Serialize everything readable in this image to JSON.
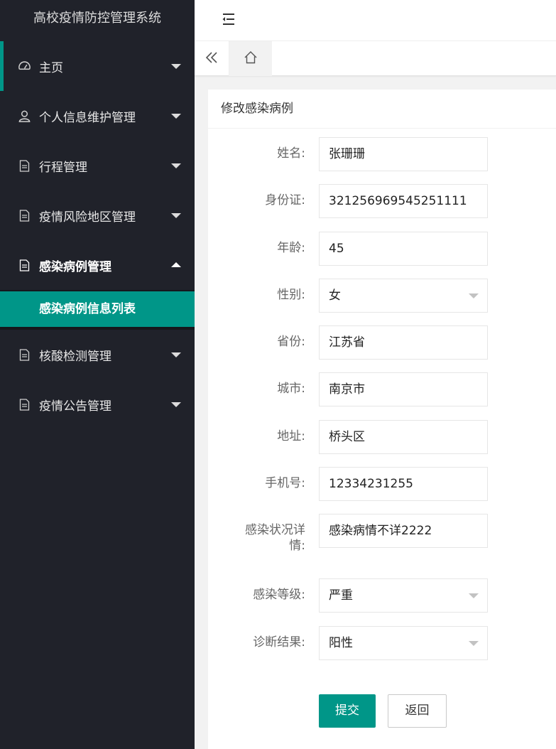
{
  "app": {
    "title": "高校疫情防控管理系统"
  },
  "sidebar": {
    "items": [
      {
        "label": "主页",
        "icon": "dashboard-icon"
      },
      {
        "label": "个人信息维护管理",
        "icon": "user-icon"
      },
      {
        "label": "行程管理",
        "icon": "document-icon"
      },
      {
        "label": "疫情风险地区管理",
        "icon": "document-icon"
      },
      {
        "label": "感染病例管理",
        "icon": "document-icon",
        "expanded": true
      },
      {
        "label": "核酸检测管理",
        "icon": "document-icon"
      },
      {
        "label": "疫情公告管理",
        "icon": "document-icon"
      }
    ],
    "active_sub": {
      "label": "感染病例信息列表"
    }
  },
  "header": {
    "menu_toggle_icon": "menu-fold-icon"
  },
  "tabs": {
    "back_icon": "double-chevron-left-icon",
    "home_icon": "home-icon"
  },
  "form": {
    "title": "修改感染病例",
    "fields": [
      {
        "label": "姓名:",
        "value": "张珊珊"
      },
      {
        "label": "身份证:",
        "value": "321256969545251111"
      },
      {
        "label": "年龄:",
        "value": "45"
      },
      {
        "label": "性别:",
        "value": "女",
        "type": "select"
      },
      {
        "label": "省份:",
        "value": "江苏省"
      },
      {
        "label": "城市:",
        "value": "南京市"
      },
      {
        "label": "地址:",
        "value": "桥头区"
      },
      {
        "label": "手机号:",
        "value": "12334231255"
      },
      {
        "label": "感染状况详情:",
        "label_line1": "感染状况详",
        "label_line2": "情:",
        "value": "感染病情不详2222"
      },
      {
        "label": "感染等级:",
        "value": "严重",
        "type": "select"
      },
      {
        "label": "诊断结果:",
        "value": "阳性",
        "type": "select"
      }
    ],
    "submit_label": "提交",
    "back_label": "返回"
  },
  "colors": {
    "accent": "#009688",
    "sidebar_bg": "#20222a",
    "sidebar_sub_bg": "#16171c"
  }
}
